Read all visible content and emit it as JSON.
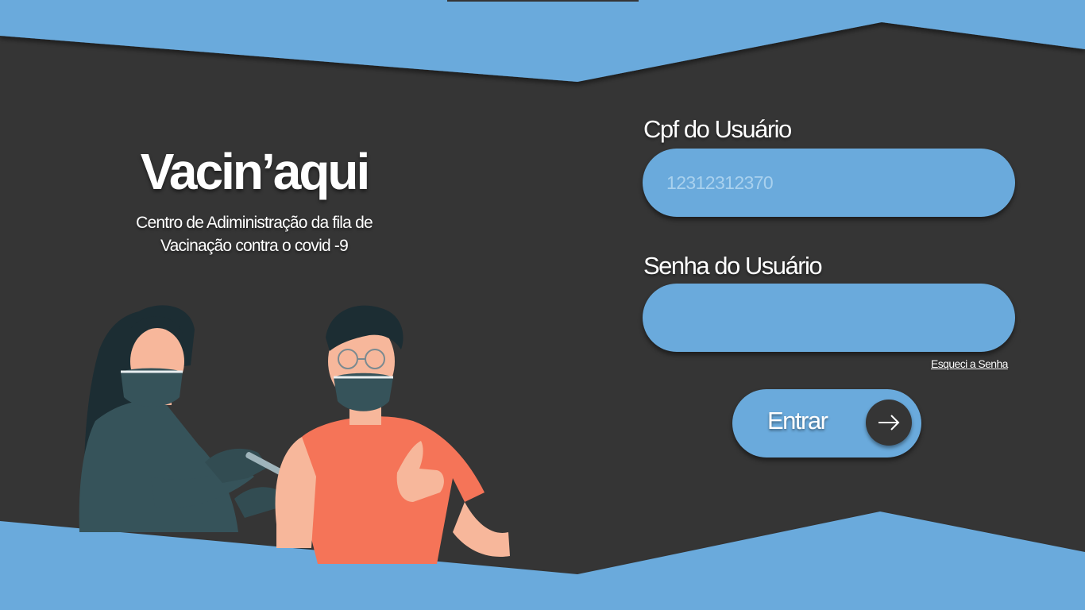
{
  "app": {
    "title": "Vacin’aqui",
    "subtitle_line1": "Centro de Adiministração da fila de",
    "subtitle_line2": "Vacinação contra o covid -9"
  },
  "form": {
    "cpf_label": "Cpf do Usuário",
    "cpf_placeholder": "12312312370",
    "cpf_value": "",
    "password_label": "Senha do Usuário",
    "password_value": "",
    "forgot_link": "Esqueci a Senha",
    "submit_label": "Entrar",
    "submit_icon": "arrow-right-icon"
  },
  "illustration": {
    "name": "healthcare-worker-vaccinating-patient",
    "icon": "vaccination-illustration"
  },
  "colors": {
    "background": "#353535",
    "accent": "#6aaadc",
    "text": "#ffffff",
    "placeholder": "#a9d1ee"
  }
}
